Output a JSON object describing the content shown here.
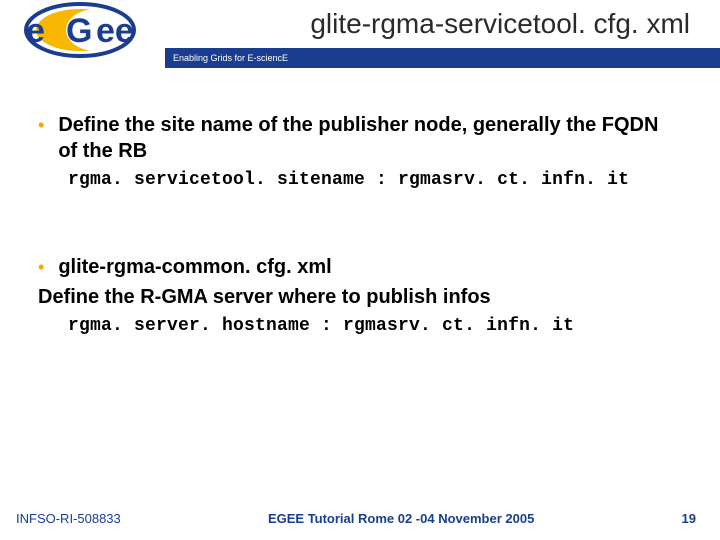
{
  "header": {
    "title": "glite-rgma-servicetool. cfg. xml",
    "tagline": "Enabling Grids for E-sciencE",
    "logo_text_top": "e",
    "logo_text_bottom": "ee",
    "logo_text_g": "G"
  },
  "content": {
    "bullet1": "Define the site name of the publisher node, generally the FQDN of the RB",
    "code1": "rgma. servicetool. sitename : rgmasrv. ct. infn. it",
    "bullet2": "glite-rgma-common. cfg. xml",
    "line2": "Define the R-GMA server where to publish infos",
    "code2": "rgma. server. hostname : rgmasrv. ct. infn. it"
  },
  "footer": {
    "left": "INFSO-RI-508833",
    "center": "EGEE Tutorial Rome 02 -04 November 2005",
    "page": "19"
  }
}
